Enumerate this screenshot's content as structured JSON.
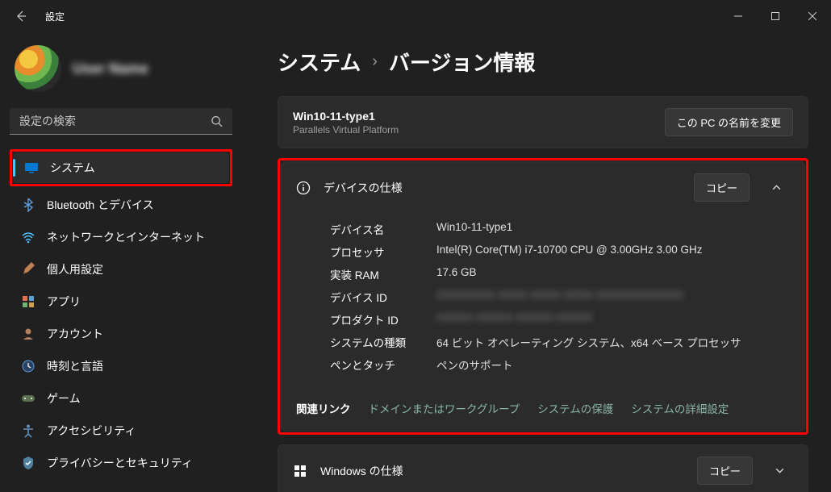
{
  "window": {
    "title": "設定"
  },
  "profile": {
    "name": "User Name"
  },
  "search": {
    "placeholder": "設定の検索"
  },
  "sidebar": {
    "items": [
      {
        "label": "システム",
        "icon": "system",
        "selected": true
      },
      {
        "label": "Bluetooth とデバイス",
        "icon": "bluetooth"
      },
      {
        "label": "ネットワークとインターネット",
        "icon": "network"
      },
      {
        "label": "個人用設定",
        "icon": "personalize"
      },
      {
        "label": "アプリ",
        "icon": "apps"
      },
      {
        "label": "アカウント",
        "icon": "account"
      },
      {
        "label": "時刻と言語",
        "icon": "time"
      },
      {
        "label": "ゲーム",
        "icon": "game"
      },
      {
        "label": "アクセシビリティ",
        "icon": "accessibility"
      },
      {
        "label": "プライバシーとセキュリティ",
        "icon": "privacy"
      }
    ]
  },
  "breadcrumb": {
    "parent": "システム",
    "current": "バージョン情報"
  },
  "pcname": {
    "name": "Win10-11-type1",
    "platform": "Parallels Virtual Platform",
    "rename_btn": "この PC の名前を変更"
  },
  "device_panel": {
    "title": "デバイスの仕様",
    "copy_btn": "コピー",
    "rows": [
      {
        "k": "デバイス名",
        "v": "Win10-11-type1"
      },
      {
        "k": "プロセッサ",
        "v": "Intel(R) Core(TM) i7-10700 CPU @ 3.00GHz   3.00 GHz"
      },
      {
        "k": "実装 RAM",
        "v": "17.6 GB"
      },
      {
        "k": "デバイス ID",
        "v": "XXXXXXXX-XXXX-XXXX-XXXX-XXXXXXXXXXXX",
        "blur": true
      },
      {
        "k": "プロダクト ID",
        "v": "XXXXX-XXXXX-XXXXX-XXXXX",
        "blur": true
      },
      {
        "k": "システムの種類",
        "v": "64 ビット オペレーティング システム、x64 ベース プロセッサ"
      },
      {
        "k": "ペンとタッチ",
        "v": "ペンのサポート"
      }
    ],
    "related_label": "関連リンク",
    "related_links": [
      "ドメインまたはワークグループ",
      "システムの保護",
      "システムの詳細設定"
    ]
  },
  "windows_panel": {
    "title": "Windows の仕様",
    "copy_btn": "コピー"
  }
}
